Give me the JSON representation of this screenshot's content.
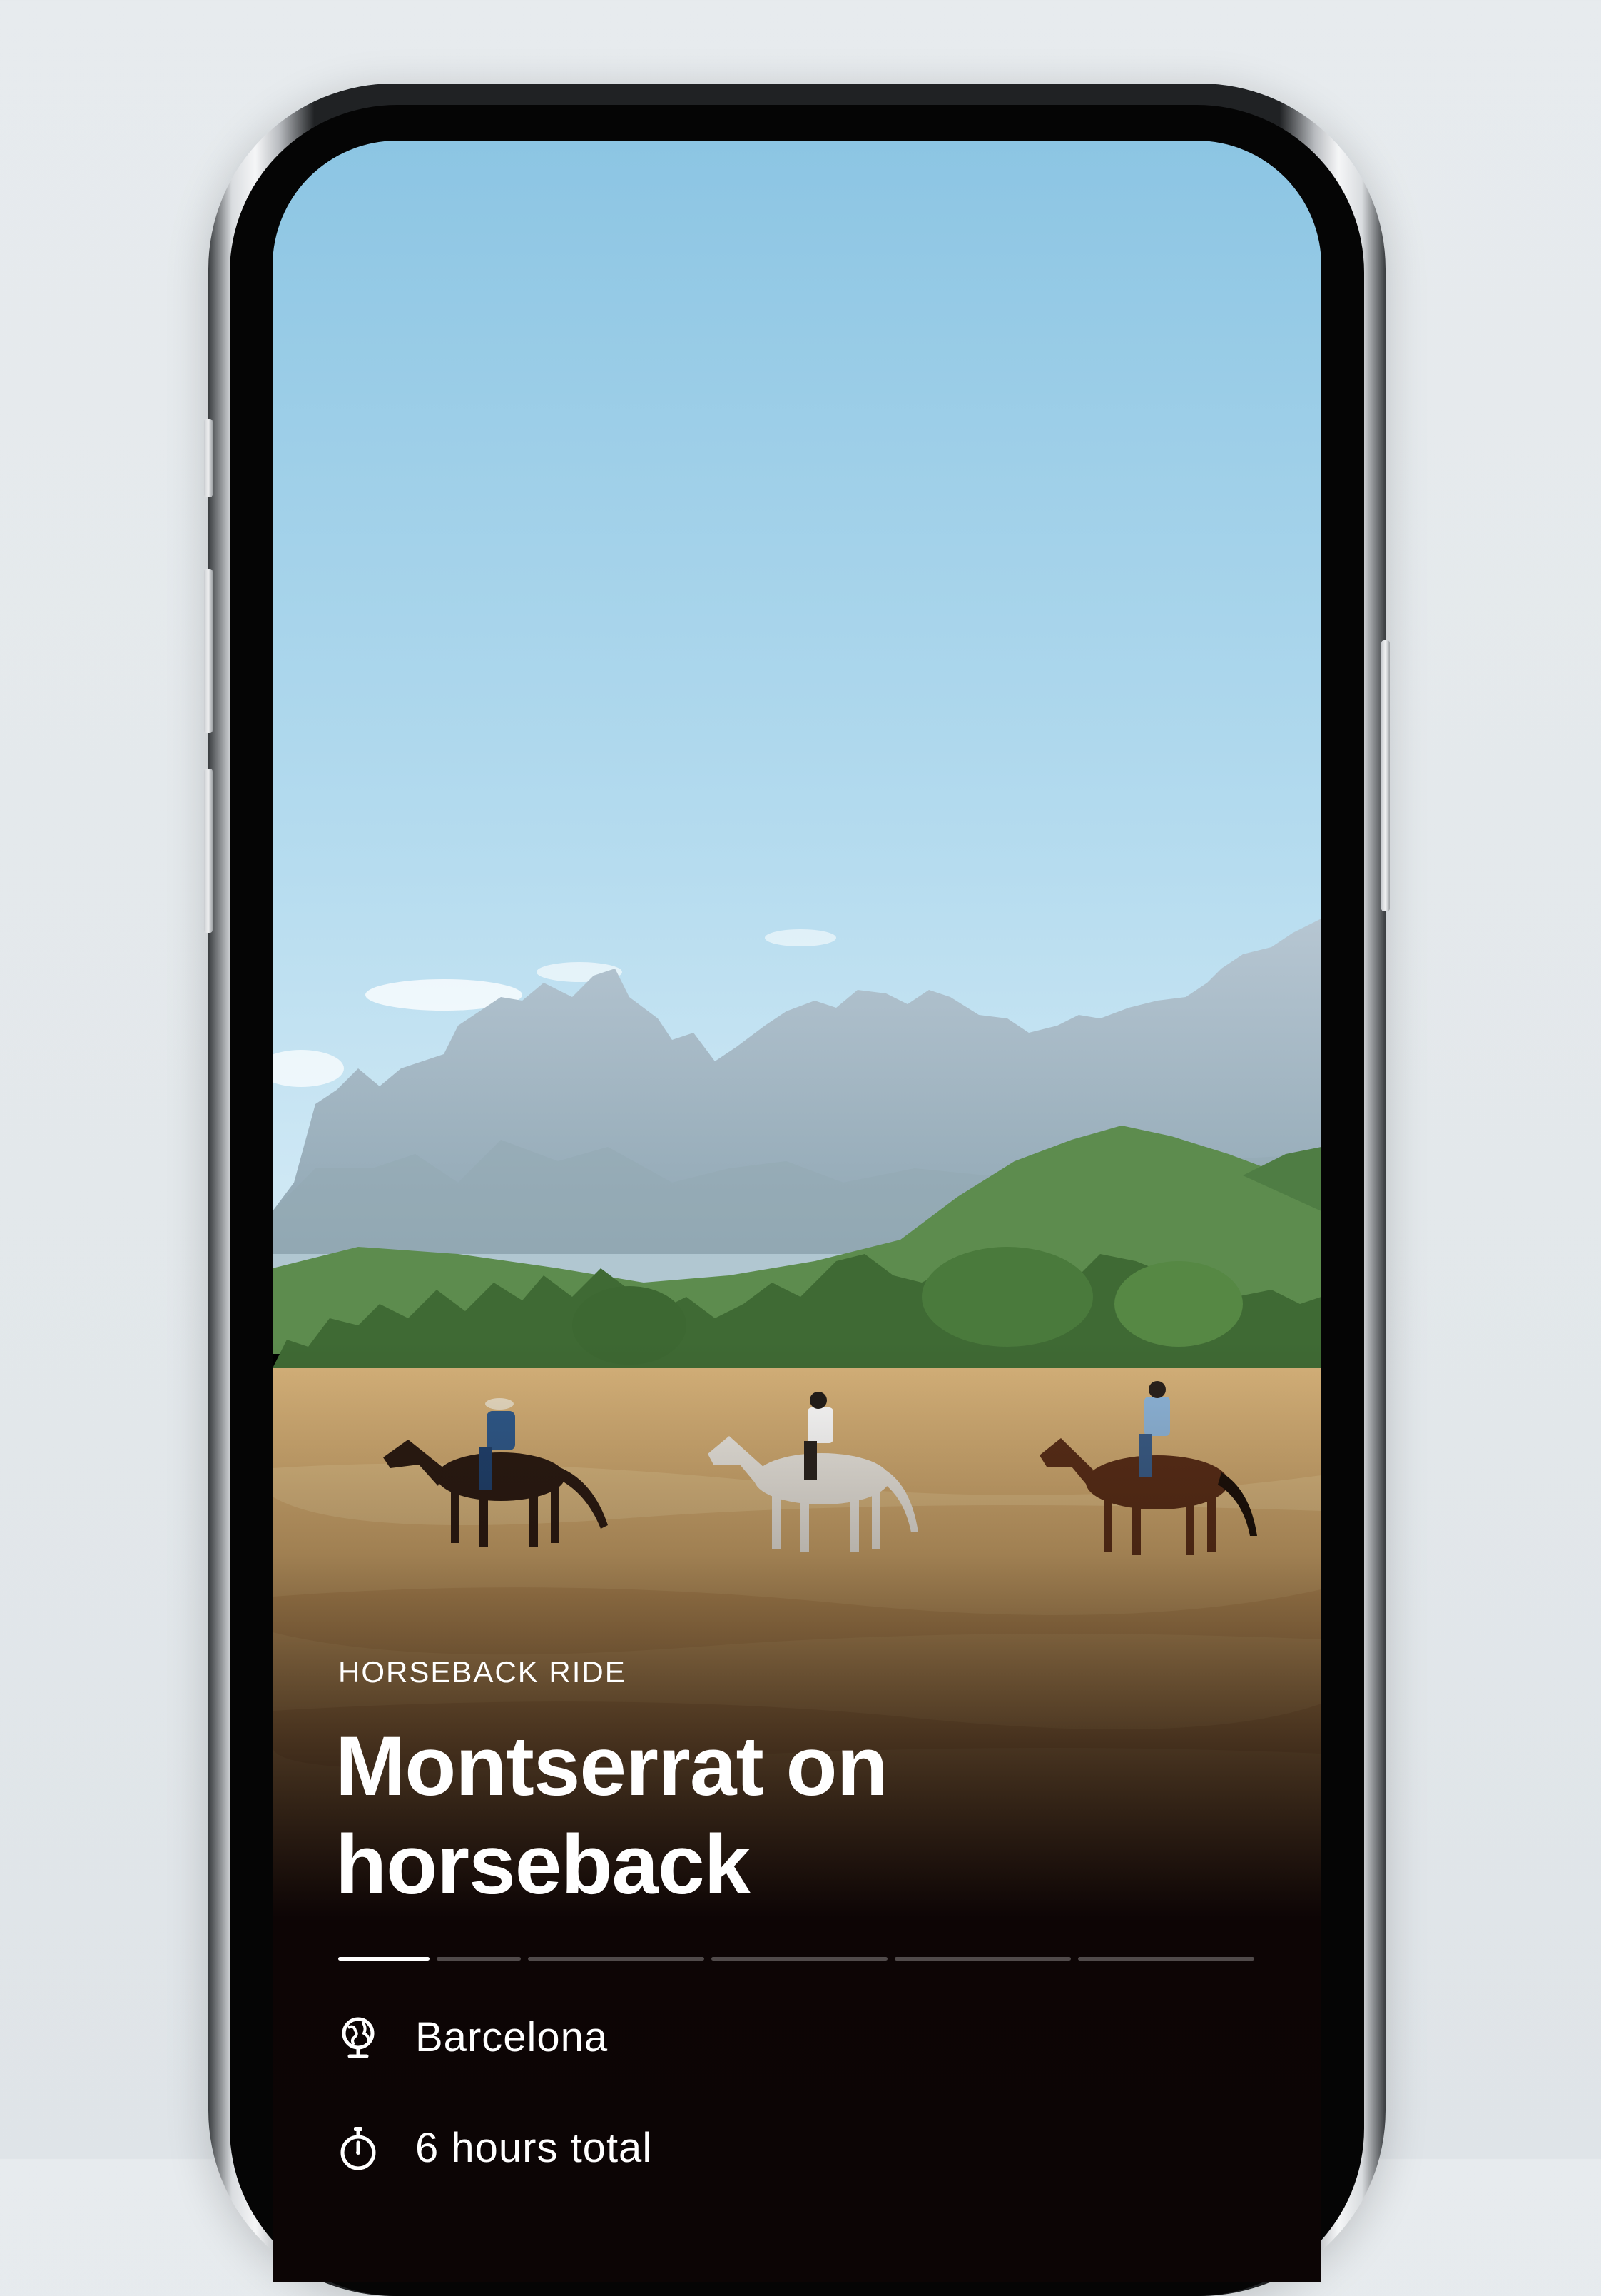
{
  "card": {
    "category": "HORSEBACK RIDE",
    "title": "Montserrat on horseback",
    "progress": {
      "segments": 6,
      "active_index": 0
    },
    "details": [
      {
        "icon": "globe-icon",
        "text": "Barcelona"
      },
      {
        "icon": "stopwatch-icon",
        "text": "6 hours total"
      }
    ]
  },
  "colors": {
    "sky_top": "#8ec5e2",
    "sky_bottom": "#dbeef8",
    "mountain": "#a7bcca",
    "field": "#d8b074",
    "dark_panel": "#0c0505",
    "text": "#ffffff"
  }
}
